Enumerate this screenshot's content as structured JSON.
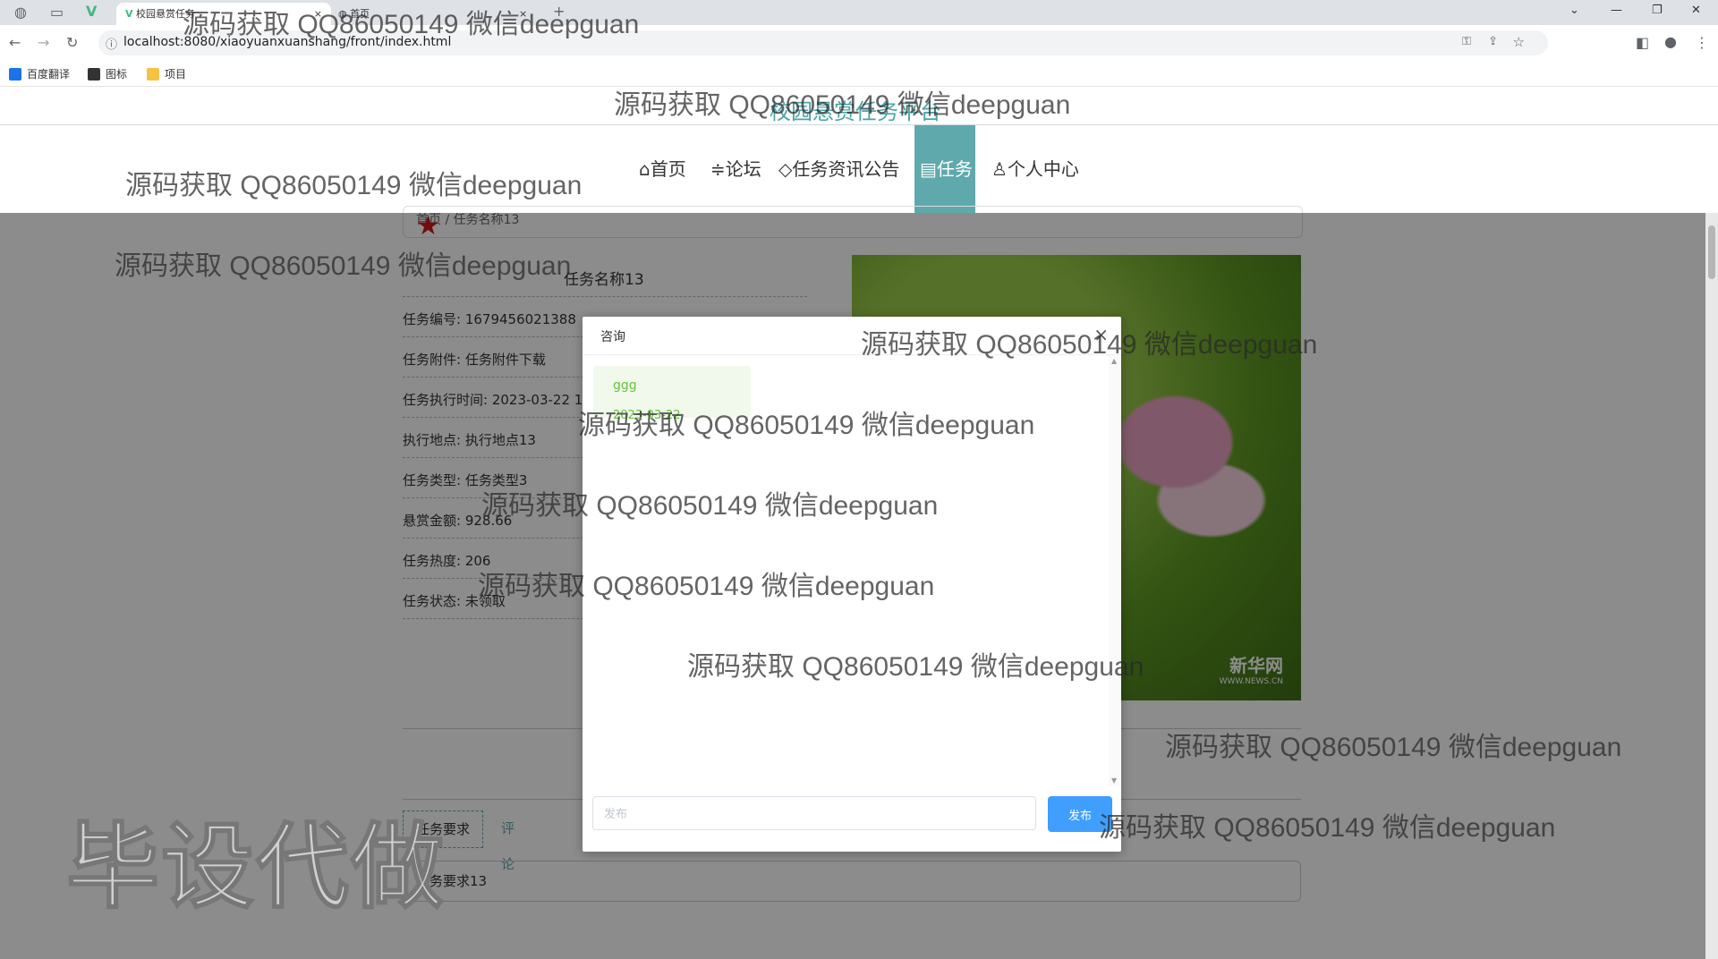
{
  "browser": {
    "tabs": [
      {
        "label": ""
      },
      {
        "label": ""
      },
      {
        "label": "校园悬赏任务"
      },
      {
        "label": "首页"
      }
    ],
    "url": "localhost:8080/xiaoyuanxuanshang/front/index.html",
    "bookmarks": [
      {
        "label": "百度翻译",
        "color": "#1a73e8"
      },
      {
        "label": "图标",
        "color": "#333333"
      },
      {
        "label": "项目",
        "color": "#f5c242"
      }
    ]
  },
  "site": {
    "title": "校园悬赏任务平台",
    "nav": [
      {
        "icon": "⌂",
        "label": "首页"
      },
      {
        "icon": "≑",
        "label": "论坛"
      },
      {
        "icon": "◇",
        "label": "任务资讯公告"
      },
      {
        "icon": "▤",
        "label": "任务"
      },
      {
        "icon": "♙",
        "label": "个人中心"
      }
    ],
    "accent": "#5fa9ad"
  },
  "detail": {
    "breadcrumb": "首页 / 任务名称13",
    "task_title": "任务名称13",
    "fields": [
      "任务编号: 1679456021388",
      "任务附件: 任务附件下载",
      "任务执行时间: 2023-03-22 1",
      "执行地点: 执行地点13",
      "任务类型: 任务类型3",
      "悬赏金额: 928.66",
      "任务热度: 206",
      "任务状态: 未领取"
    ],
    "image_logo": "新华网",
    "image_logo_sub": "WWW.NEWS.CN",
    "tabs": [
      "任务要求",
      "评论"
    ],
    "requirement": "任务要求13"
  },
  "dialog": {
    "title": "咨询",
    "close": "×",
    "messages": [
      {
        "text": "ggg",
        "sub": "2023-03-22"
      }
    ],
    "input_placeholder": "发布",
    "submit_label": "发布"
  },
  "watermarks": {
    "text": "源码获取 QQ86050149 微信deepguan",
    "big": "毕设代做"
  }
}
